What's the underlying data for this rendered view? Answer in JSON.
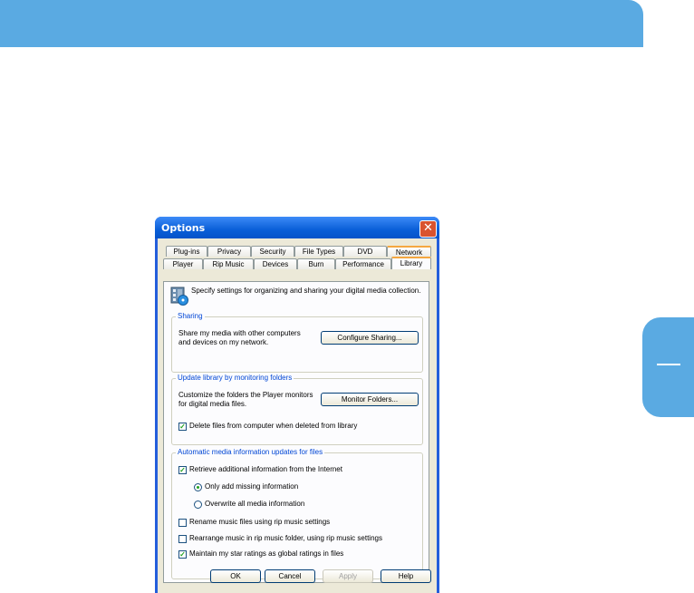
{
  "dialog": {
    "title": "Options",
    "close_glyph": "✕"
  },
  "tabs": {
    "back_row": [
      "Plug-ins",
      "Privacy",
      "Security",
      "File Types",
      "DVD",
      "Network"
    ],
    "front_row": [
      "Player",
      "Rip Music",
      "Devices",
      "Burn",
      "Performance",
      "Library"
    ],
    "active": "Library"
  },
  "library": {
    "icon": "library-icon",
    "intro": "Specify settings for organizing and sharing your digital media collection.",
    "sharing": {
      "label": "Sharing",
      "description": "Share my media with other computers and devices on my network.",
      "button": "Configure Sharing..."
    },
    "monitoring": {
      "label": "Update library by monitoring folders",
      "description": "Customize the folders the Player monitors for digital media files.",
      "button": "Monitor Folders...",
      "delete_files": {
        "label": "Delete files from computer when deleted from library",
        "checked": true
      }
    },
    "auto_updates": {
      "label": "Automatic media information updates for files",
      "retrieve": {
        "label": "Retrieve additional information from the Internet",
        "checked": true
      },
      "only_add": {
        "label": "Only add missing information",
        "selected": true
      },
      "overwrite": {
        "label": "Overwrite all media information",
        "selected": false
      },
      "rename": {
        "label": "Rename music files using rip music settings",
        "checked": false
      },
      "rearrange": {
        "label": "Rearrange music in rip music folder, using rip music settings",
        "checked": false
      },
      "maintain": {
        "label": "Maintain my star ratings as global ratings in files",
        "checked": true
      }
    }
  },
  "footer": {
    "ok": "OK",
    "cancel": "Cancel",
    "apply": "Apply",
    "help": "Help"
  },
  "colors": {
    "banner": "#5aaae2",
    "titlebar": "#0a5fd8",
    "group_label": "#0046d5",
    "check": "#21a121"
  }
}
